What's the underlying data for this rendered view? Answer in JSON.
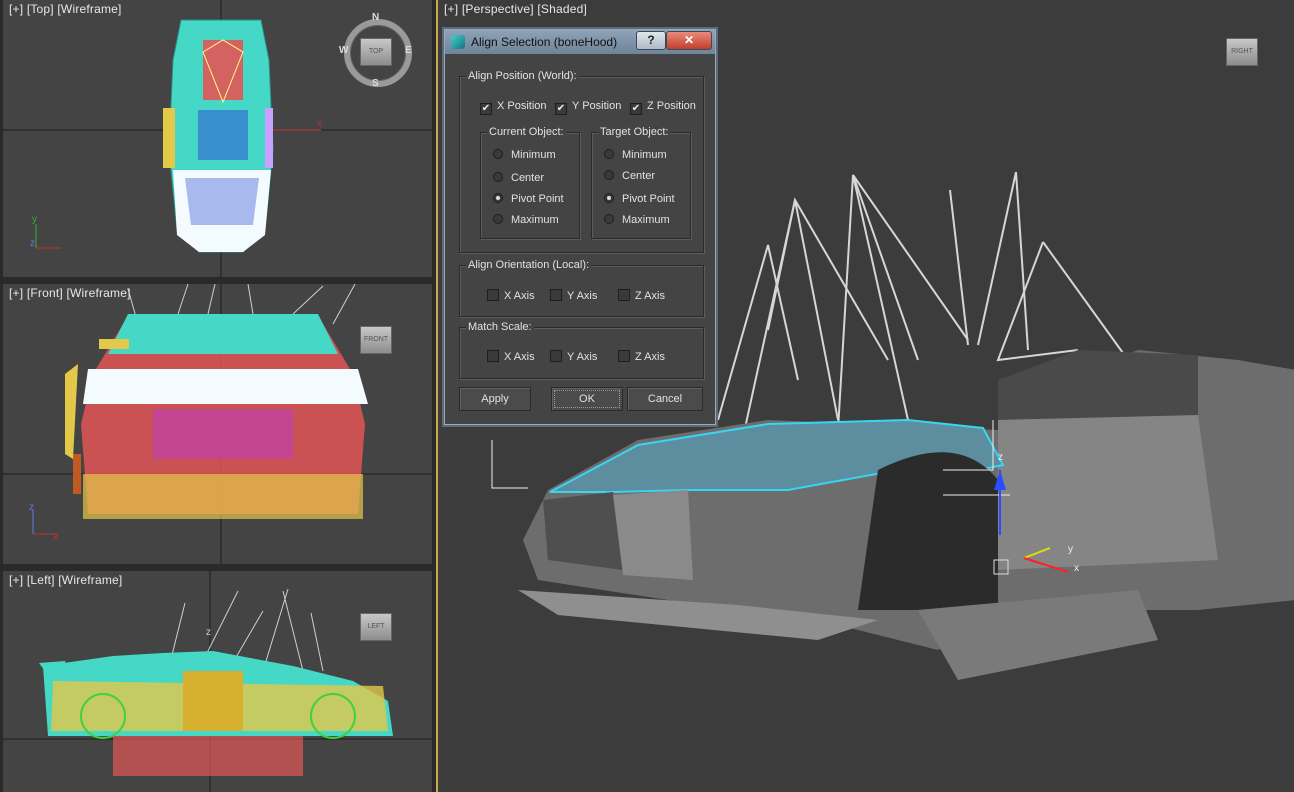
{
  "viewports": {
    "top": {
      "plus": "[+]",
      "view": "[Top]",
      "mode": "[Wireframe]",
      "cube": "TOP",
      "compass": {
        "n": "N",
        "s": "S",
        "e": "E",
        "w": "W"
      },
      "axis_x": "x",
      "axis_y": "y",
      "axis_z": "z"
    },
    "front": {
      "plus": "[+]",
      "view": "[Front]",
      "mode": "[Wireframe]",
      "cube": "FRONT",
      "axis_x": "x",
      "axis_z": "z"
    },
    "left": {
      "plus": "[+]",
      "view": "[Left]",
      "mode": "[Wireframe]",
      "cube": "LEFT",
      "axis_z": "z"
    },
    "perspective": {
      "plus": "[+]",
      "view": "[Perspective]",
      "mode": "[Shaded]",
      "cube": "RIGHT",
      "gizmo_x": "x",
      "gizmo_y": "y",
      "gizmo_z": "z"
    }
  },
  "dialog": {
    "title": "Align Selection (boneHood)",
    "help": "?",
    "close": "✕",
    "align_position": {
      "title": "Align Position (World):",
      "x": {
        "label": "X Position",
        "checked": true
      },
      "y": {
        "label": "Y Position",
        "checked": true
      },
      "z": {
        "label": "Z Position",
        "checked": true
      },
      "current": {
        "title": "Current Object:",
        "options": [
          "Minimum",
          "Center",
          "Pivot Point",
          "Maximum"
        ],
        "selected": "Pivot Point"
      },
      "target": {
        "title": "Target Object:",
        "options": [
          "Minimum",
          "Center",
          "Pivot Point",
          "Maximum"
        ],
        "selected": "Pivot Point"
      }
    },
    "align_orientation": {
      "title": "Align Orientation (Local):",
      "x": "X Axis",
      "y": "Y Axis",
      "z": "Z Axis"
    },
    "match_scale": {
      "title": "Match Scale:",
      "x": "X Axis",
      "y": "Y Axis",
      "z": "Z Axis"
    },
    "buttons": {
      "apply": "Apply",
      "ok": "OK",
      "cancel": "Cancel"
    }
  },
  "check_glyph": "✔"
}
